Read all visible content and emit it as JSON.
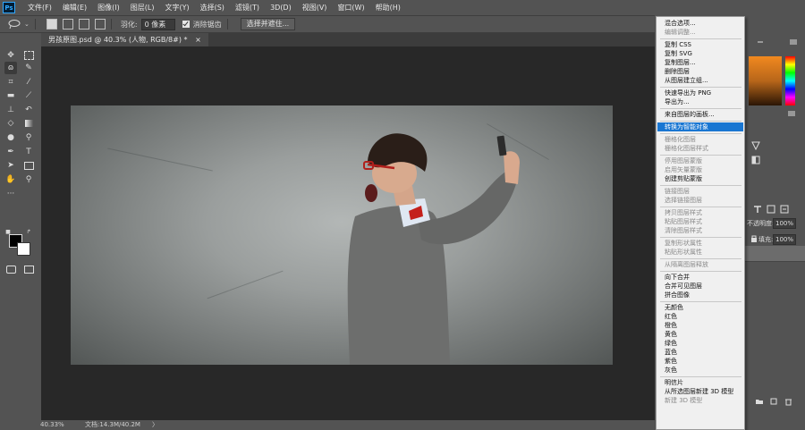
{
  "app": {
    "logo_text": "Ps"
  },
  "menu": [
    "文件(F)",
    "编辑(E)",
    "图像(I)",
    "图层(L)",
    "文字(Y)",
    "选择(S)",
    "滤镜(T)",
    "3D(D)",
    "视图(V)",
    "窗口(W)",
    "帮助(H)"
  ],
  "options_bar": {
    "feather_label": "羽化:",
    "feather_value": "0 像素",
    "antialias_label": "消除锯齿",
    "antialias_checked": true,
    "select_mask_button": "选择并遮住..."
  },
  "document": {
    "tab_title": "男孩原图.psd @ 40.3% (人物, RGB/8#) *",
    "close_symbol": "×"
  },
  "status": {
    "zoom": "40.33%",
    "doc_info": "文档:14.3M/40.2M",
    "arrow": "〉"
  },
  "layers_panel": {
    "opacity_label": "不透明度:",
    "opacity_value": "100%",
    "fill_label": "填充:",
    "fill_value": "100%"
  },
  "context_menu": [
    {
      "label": "混合选项...",
      "enabled": true
    },
    {
      "label": "编辑调整...",
      "enabled": false
    },
    {
      "sep": true
    },
    {
      "label": "复制 CSS",
      "enabled": true
    },
    {
      "label": "复制 SVG",
      "enabled": true
    },
    {
      "label": "复制图层...",
      "enabled": true
    },
    {
      "label": "删除图层",
      "enabled": true
    },
    {
      "label": "从图层建立组...",
      "enabled": true
    },
    {
      "sep": true
    },
    {
      "label": "快速导出为 PNG",
      "enabled": true
    },
    {
      "label": "导出为...",
      "enabled": true
    },
    {
      "sep": true
    },
    {
      "label": "来自图层的画板...",
      "enabled": true
    },
    {
      "sep": true
    },
    {
      "label": "转换为智能对象",
      "enabled": true,
      "highlighted": true
    },
    {
      "sep": true
    },
    {
      "label": "栅格化图层",
      "enabled": false
    },
    {
      "label": "栅格化图层样式",
      "enabled": false
    },
    {
      "sep": true
    },
    {
      "label": "停用图层蒙版",
      "enabled": false
    },
    {
      "label": "启用矢量蒙版",
      "enabled": false
    },
    {
      "label": "创建剪贴蒙版",
      "enabled": true
    },
    {
      "sep": true
    },
    {
      "label": "链接图层",
      "enabled": false
    },
    {
      "label": "选择链接图层",
      "enabled": false
    },
    {
      "sep": true
    },
    {
      "label": "拷贝图层样式",
      "enabled": false
    },
    {
      "label": "粘贴图层样式",
      "enabled": false
    },
    {
      "label": "清除图层样式",
      "enabled": false
    },
    {
      "sep": true
    },
    {
      "label": "复制形状属性",
      "enabled": false
    },
    {
      "label": "粘贴形状属性",
      "enabled": false
    },
    {
      "sep": true
    },
    {
      "label": "从隔离图层释放",
      "enabled": false
    },
    {
      "sep": true
    },
    {
      "label": "向下合并",
      "enabled": true
    },
    {
      "label": "合并可见图层",
      "enabled": true
    },
    {
      "label": "拼合图像",
      "enabled": true
    },
    {
      "sep": true
    },
    {
      "label": "无颜色",
      "enabled": true
    },
    {
      "label": "红色",
      "enabled": true
    },
    {
      "label": "橙色",
      "enabled": true
    },
    {
      "label": "黄色",
      "enabled": true
    },
    {
      "label": "绿色",
      "enabled": true
    },
    {
      "label": "蓝色",
      "enabled": true
    },
    {
      "label": "紫色",
      "enabled": true
    },
    {
      "label": "灰色",
      "enabled": true
    },
    {
      "sep": true
    },
    {
      "label": "明信片",
      "enabled": true
    },
    {
      "label": "从所选图层新建 3D 模型",
      "enabled": true
    },
    {
      "label": "新建 3D 模型",
      "enabled": false
    }
  ],
  "colors": {
    "ui_dark": "#535353",
    "canvas_bg": "#282828",
    "menu_bg": "#f0f0f0",
    "menu_highlight": "#1976d2",
    "foreground_swatch": "#000000",
    "background_swatch": "#ffffff"
  }
}
